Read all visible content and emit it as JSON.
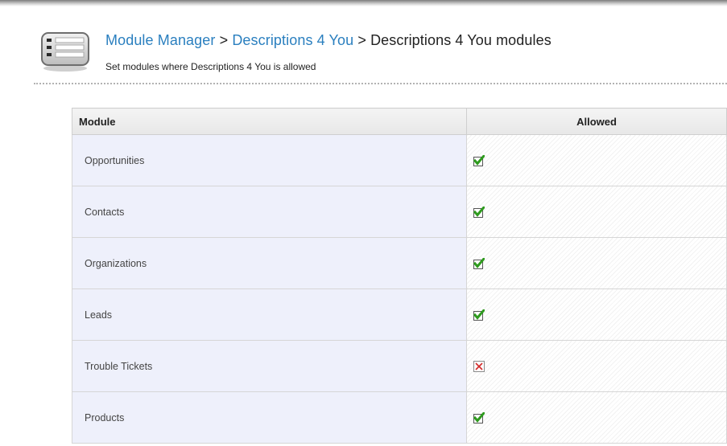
{
  "header": {
    "breadcrumb": {
      "module_manager": "Module Manager",
      "separator": ">",
      "descriptions_link": "Descriptions 4 You",
      "current": "Descriptions 4 You modules"
    },
    "subtitle": "Set modules where Descriptions 4 You is allowed",
    "icon": "list-settings-icon"
  },
  "table": {
    "columns": [
      "Module",
      "Allowed"
    ],
    "rows": [
      {
        "module": "Opportunities",
        "allowed": true
      },
      {
        "module": "Contacts",
        "allowed": true
      },
      {
        "module": "Organizations",
        "allowed": true
      },
      {
        "module": "Leads",
        "allowed": true
      },
      {
        "module": "Trouble Tickets",
        "allowed": false
      },
      {
        "module": "Products",
        "allowed": true
      }
    ]
  },
  "colors": {
    "link": "#2a7fbf",
    "check_green": "#2e9a1e",
    "cross_red": "#d22a2a",
    "module_cell_bg": "#eef0fb"
  }
}
